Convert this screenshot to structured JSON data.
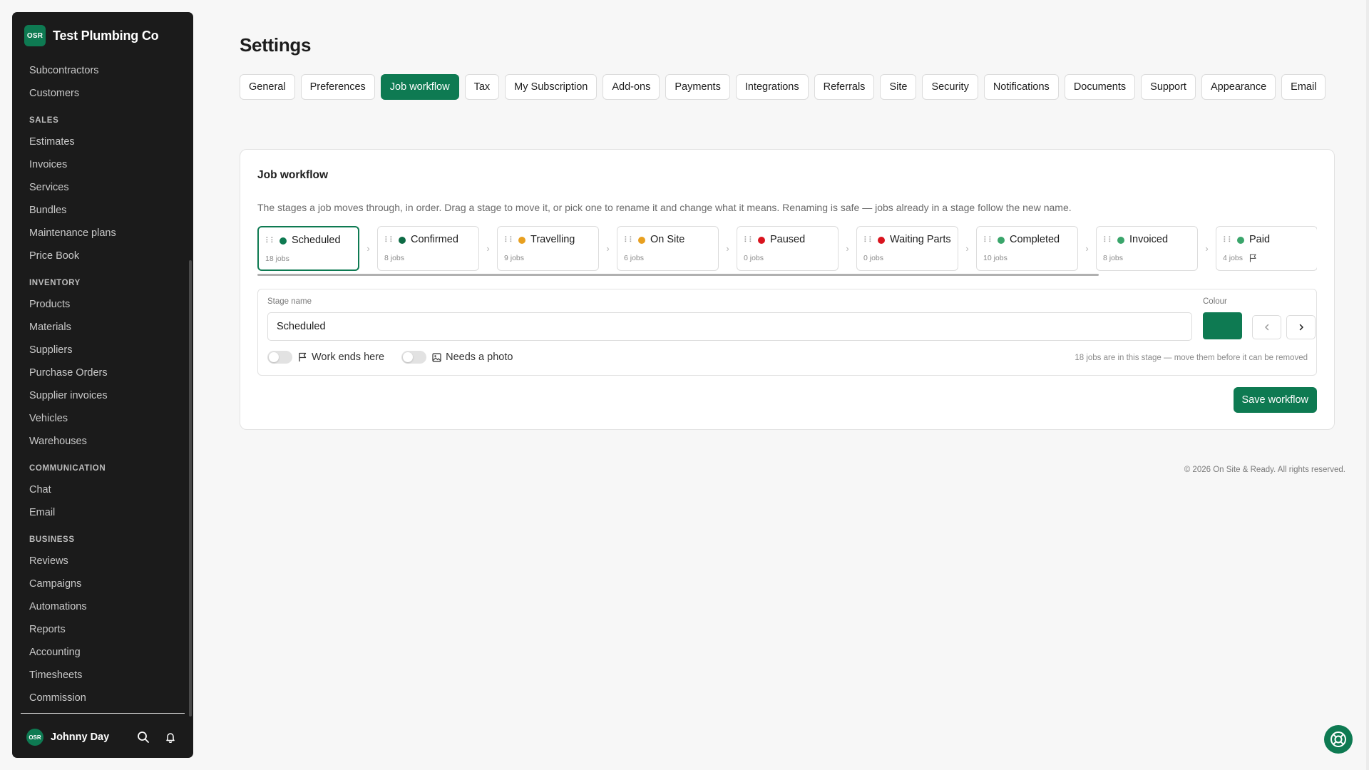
{
  "brand": {
    "logo_text": "OSR",
    "name": "Test Plumbing Co"
  },
  "sidebar": {
    "items_top": [
      "Subcontractors",
      "Customers"
    ],
    "groups": [
      {
        "label": "SALES",
        "items": [
          "Estimates",
          "Invoices",
          "Services",
          "Bundles",
          "Maintenance plans",
          "Price Book"
        ]
      },
      {
        "label": "INVENTORY",
        "items": [
          "Products",
          "Materials",
          "Suppliers",
          "Purchase Orders",
          "Supplier invoices",
          "Vehicles",
          "Warehouses"
        ]
      },
      {
        "label": "COMMUNICATION",
        "items": [
          "Chat",
          "Email"
        ]
      },
      {
        "label": "BUSINESS",
        "items": [
          "Reviews",
          "Campaigns",
          "Automations",
          "Reports",
          "Accounting",
          "Timesheets",
          "Commission"
        ]
      }
    ]
  },
  "user": {
    "avatar_text": "OSR",
    "name": "Johnny Day"
  },
  "page": {
    "title": "Settings"
  },
  "tabs": [
    "General",
    "Preferences",
    "Job workflow",
    "Tax",
    "My Subscription",
    "Add-ons",
    "Payments",
    "Integrations",
    "Referrals",
    "Site",
    "Security",
    "Notifications",
    "Documents",
    "Support",
    "Appearance",
    "Email"
  ],
  "active_tab": "Job workflow",
  "workflow": {
    "title": "Job workflow",
    "description": "The stages a job moves through, in order. Drag a stage to move it, or pick one to rename it and change what it means. Renaming is safe — jobs already in a stage follow the new name.",
    "stages": [
      {
        "name": "Scheduled",
        "count": "18 jobs",
        "color": "#0e7a52",
        "selected": true,
        "flag": false
      },
      {
        "name": "Confirmed",
        "count": "8 jobs",
        "color": "#0e6b45",
        "selected": false,
        "flag": false
      },
      {
        "name": "Travelling",
        "count": "9 jobs",
        "color": "#e8a020",
        "selected": false,
        "flag": false
      },
      {
        "name": "On Site",
        "count": "6 jobs",
        "color": "#e8a020",
        "selected": false,
        "flag": false
      },
      {
        "name": "Paused",
        "count": "0 jobs",
        "color": "#d9141e",
        "selected": false,
        "flag": false
      },
      {
        "name": "Waiting Parts",
        "count": "0 jobs",
        "color": "#d9141e",
        "selected": false,
        "flag": false
      },
      {
        "name": "Completed",
        "count": "10 jobs",
        "color": "#3aa56b",
        "selected": false,
        "flag": false
      },
      {
        "name": "Invoiced",
        "count": "8 jobs",
        "color": "#3aa56b",
        "selected": false,
        "flag": false
      },
      {
        "name": "Paid",
        "count": "4 jobs",
        "color": "#3aa56b",
        "selected": false,
        "flag": true
      }
    ],
    "editor": {
      "stage_name_label": "Stage name",
      "stage_name_value": "Scheduled",
      "colour_label": "Colour",
      "colour_value": "#0e7a52",
      "toggle_work_ends": "Work ends here",
      "toggle_needs_photo": "Needs a photo",
      "note": "18 jobs are in this stage — move them before it can be removed"
    },
    "save_label": "Save workflow"
  },
  "footer": "© 2026 On Site & Ready. All rights reserved."
}
